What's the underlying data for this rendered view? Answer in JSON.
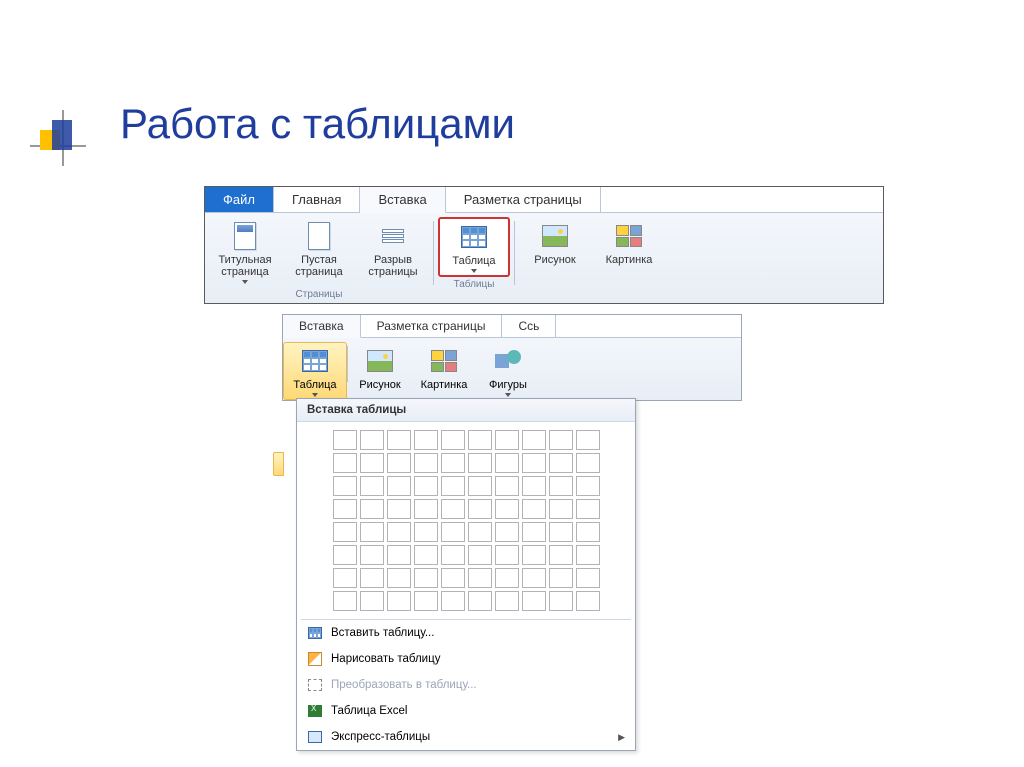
{
  "slide": {
    "title": "Работа с таблицами"
  },
  "ribbon1": {
    "tabs": {
      "file": "Файл",
      "home": "Главная",
      "insert": "Вставка",
      "layout": "Разметка страницы"
    },
    "groups": {
      "pages": {
        "name": "Страницы",
        "items": {
          "title_page": "Титульная страница",
          "blank_page": "Пустая страница",
          "page_break": "Разрыв страницы"
        }
      },
      "tables": {
        "name": "Таблицы",
        "items": {
          "table": "Таблица"
        }
      },
      "illustrations": {
        "items": {
          "picture": "Рисунок",
          "clipart": "Картинка"
        }
      }
    }
  },
  "ribbon2": {
    "tabs": {
      "insert": "Вставка",
      "layout": "Разметка страницы",
      "refs": "Ссь"
    },
    "items": {
      "table": "Таблица",
      "picture": "Рисунок",
      "clipart": "Картинка",
      "shapes": "Фигуры"
    }
  },
  "dropdown": {
    "title": "Вставка таблицы",
    "grid": {
      "cols": 10,
      "rows": 8
    },
    "menu": {
      "insert_table": "Вставить таблицу...",
      "draw_table": "Нарисовать таблицу",
      "convert": "Преобразовать в таблицу...",
      "excel": "Таблица Excel",
      "quick": "Экспресс-таблицы"
    }
  }
}
